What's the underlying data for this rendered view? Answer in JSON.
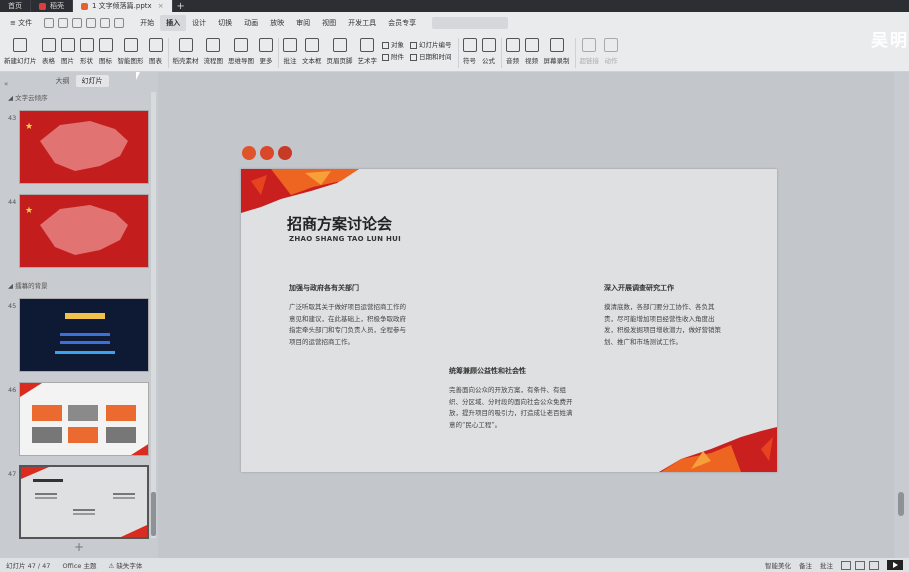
{
  "tabs": [
    {
      "label": "首页",
      "active": false
    },
    {
      "label": "稻壳",
      "active": false
    },
    {
      "label": "1 文字倾落篇.pptx",
      "active": true
    }
  ],
  "menu": {
    "file": "文件",
    "items": [
      "开始",
      "插入",
      "设计",
      "切换",
      "动画",
      "放映",
      "审阅",
      "视图",
      "开发工具",
      "会员专享"
    ],
    "active_index": 1
  },
  "ribbon": {
    "new_slide": "新建幻灯片",
    "table": "表格",
    "picture": "图片",
    "shape": "形状",
    "icon": "图标",
    "smart_graphic": "智能图形",
    "chart": "图表",
    "docer_material": "稻壳素材",
    "flowchart": "流程图",
    "mindmap": "思维导图",
    "more": "更多",
    "comment": "批注",
    "textbox": "文本框",
    "header_footer": "页眉页脚",
    "wordart": "艺术字",
    "object": "对象",
    "attachment": "附件",
    "slide_number": "幻灯片编号",
    "datetime": "日期和时间",
    "symbol": "符号",
    "formula": "公式",
    "audio": "音频",
    "video": "视频",
    "screen_record": "屏幕录制",
    "hyperlink": "超链接",
    "action": "动作"
  },
  "username": "吴明",
  "left_panel": {
    "tab_outline": "大纲",
    "tab_slides": "幻灯片",
    "section_1": "文字云倾序",
    "section_2": "擂幕的背景",
    "thumb_numbers": [
      "43",
      "44",
      "45",
      "46",
      "47"
    ]
  },
  "slide": {
    "title": "招商方案讨论会",
    "subtitle": "ZHAO SHANG TAO LUN HUI",
    "block1_title": "加强与政府各有关部门",
    "block1_body": "广泛听取其关于做好项目运营招商工作的意见和建议，在此基础上，积极争取政府指定牵头部门和专门负责人员，全程参与项目的运营招商工作。",
    "block2_title": "深入开展调查研究工作",
    "block2_body": "摸清底数，各部门要分工协作、各负其责，尽可能增加项目经营性收入角度出发，积极发掘项目增收潜力，做好营销策划、推广和市场测试工作。",
    "block3_title": "统筹兼顾公益性和社会性",
    "block3_body": "完善面向公众的开放方案，有条件、有组织、分区域、分时段的面向社会公众免费开放，提升项目的吸引力，打造成让老百姓满意的“民心工程”。"
  },
  "statusbar": {
    "slide_pos": "幻灯片 47 / 47",
    "theme": "Office 主题",
    "missing_font": "缺失字体",
    "smart_beautify": "智能美化",
    "notes": "备注",
    "comments": "批注"
  },
  "colors": {
    "accent_red": "#c9201f",
    "accent_orange": "#f26b21",
    "dot_color": "#e0542a"
  }
}
